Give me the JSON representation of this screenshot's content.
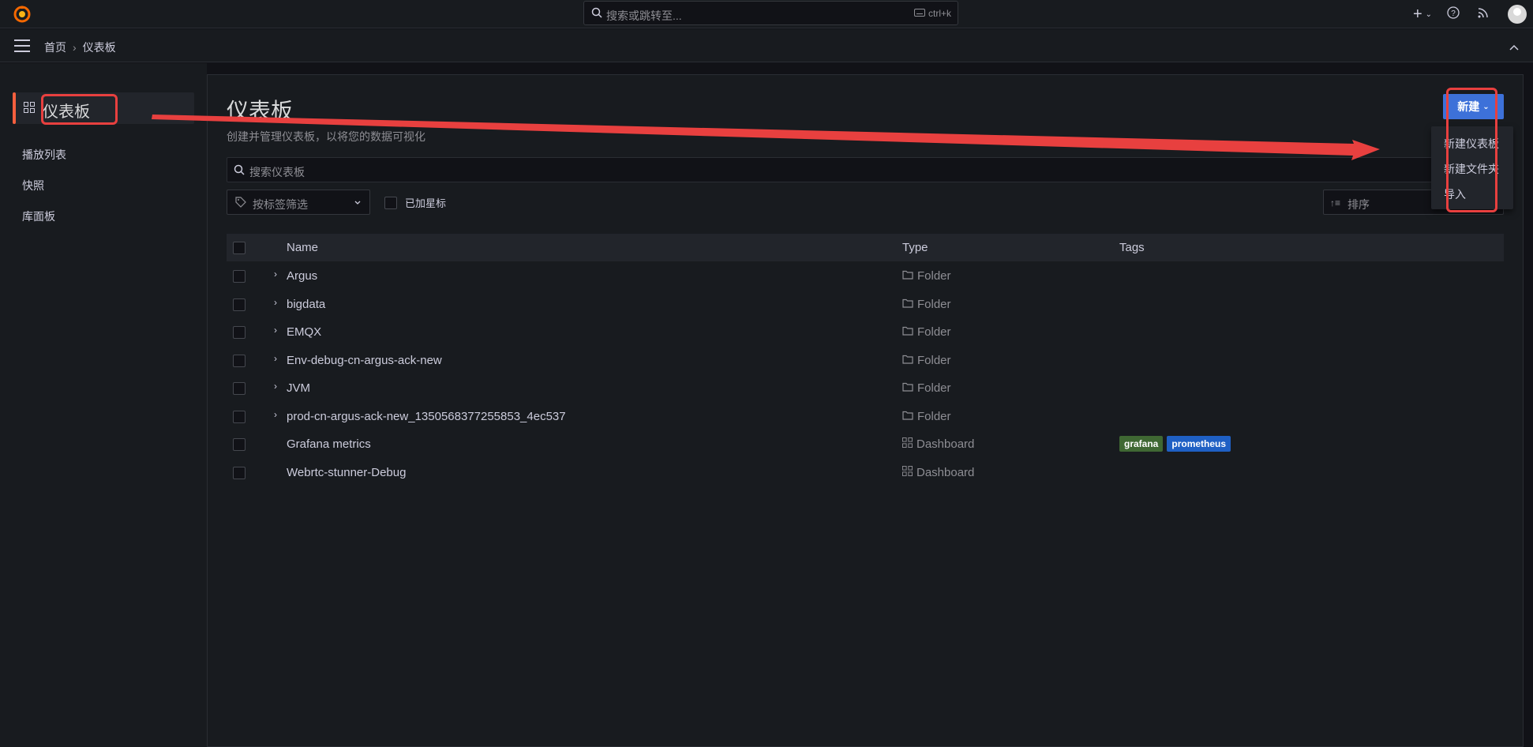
{
  "topbar": {
    "search_placeholder": "搜索或跳转至...",
    "shortcut": "ctrl+k",
    "icons": [
      "grafana-logo-icon",
      "search-icon",
      "keyboard-icon",
      "plus-icon",
      "help-icon",
      "rss-icon",
      "user-avatar"
    ]
  },
  "navbar": {
    "crumb_home": "首页",
    "crumb_sep": "›",
    "crumb_current": "仪表板"
  },
  "sidebar": {
    "active": "仪表板",
    "items": [
      "播放列表",
      "快照",
      "库面板"
    ]
  },
  "main": {
    "title": "仪表板",
    "subtitle": "创建并管理仪表板，以将您的数据可视化",
    "new_button": "新建",
    "search_placeholder": "搜索仪表板",
    "tag_filter_placeholder": "按标签筛选",
    "starred_label": "已加星标",
    "sort_placeholder": "排序",
    "columns": {
      "name": "Name",
      "type": "Type",
      "tags": "Tags"
    },
    "rows": [
      {
        "name": "Argus",
        "type": "Folder",
        "expandable": true,
        "tags": []
      },
      {
        "name": "bigdata",
        "type": "Folder",
        "expandable": true,
        "tags": []
      },
      {
        "name": "EMQX",
        "type": "Folder",
        "expandable": true,
        "tags": []
      },
      {
        "name": "Env-debug-cn-argus-ack-new",
        "type": "Folder",
        "expandable": true,
        "tags": []
      },
      {
        "name": "JVM",
        "type": "Folder",
        "expandable": true,
        "tags": []
      },
      {
        "name": "prod-cn-argus-ack-new_1350568377255853_4ec537",
        "type": "Folder",
        "expandable": true,
        "tags": []
      },
      {
        "name": "Grafana metrics",
        "type": "Dashboard",
        "expandable": false,
        "tags": [
          {
            "label": "grafana",
            "color": "#3f6833"
          },
          {
            "label": "prometheus",
            "color": "#1f60c4"
          }
        ]
      },
      {
        "name": "Webrtc-stunner-Debug",
        "type": "Dashboard",
        "expandable": false,
        "tags": []
      }
    ]
  },
  "new_menu": {
    "items": [
      "新建仪表板",
      "新建文件夹",
      "导入"
    ]
  },
  "colors": {
    "accent": "#3d71d9",
    "active_bar": "#f55f3e",
    "annotation": "#e8403f"
  }
}
